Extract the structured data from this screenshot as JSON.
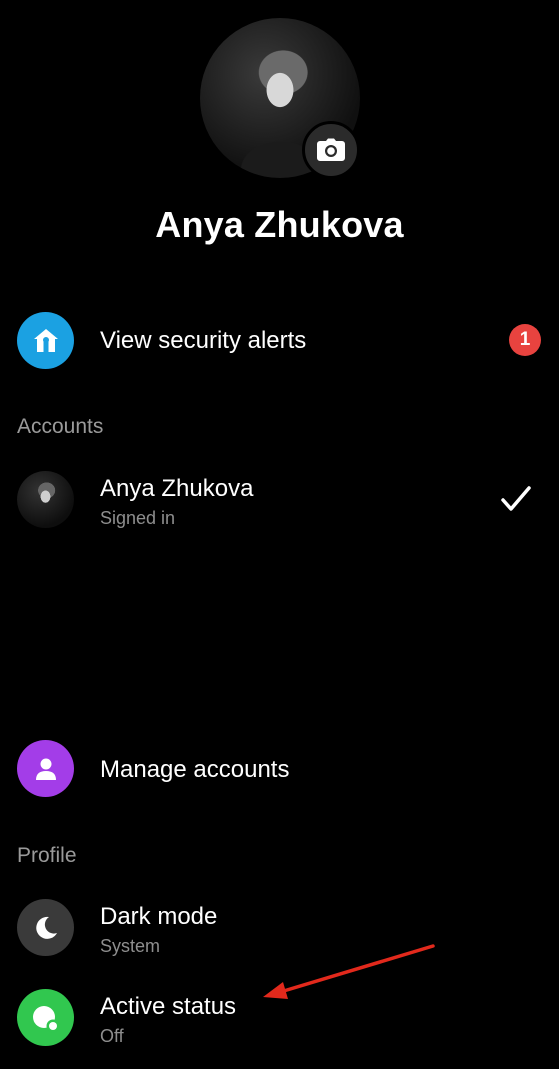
{
  "profile": {
    "name": "Anya Zhukova"
  },
  "security": {
    "label": "View security alerts",
    "badge_count": "1",
    "icon": "shield-house-icon",
    "icon_color": "#1ba1e2"
  },
  "accounts": {
    "section_label": "Accounts",
    "items": [
      {
        "name": "Anya Zhukova",
        "status": "Signed in",
        "selected": true
      }
    ],
    "manage_label": "Manage accounts",
    "manage_icon_color": "#a33de8"
  },
  "profile_section": {
    "section_label": "Profile",
    "dark_mode": {
      "label": "Dark mode",
      "value": "System",
      "icon": "moon-icon",
      "icon_color": "#3a3a3a"
    },
    "active_status": {
      "label": "Active status",
      "value": "Off",
      "icon": "active-status-icon",
      "icon_color": "#31c74f"
    }
  },
  "annotation": {
    "type": "arrow",
    "color": "#e2291c",
    "points_to": "Active status"
  }
}
